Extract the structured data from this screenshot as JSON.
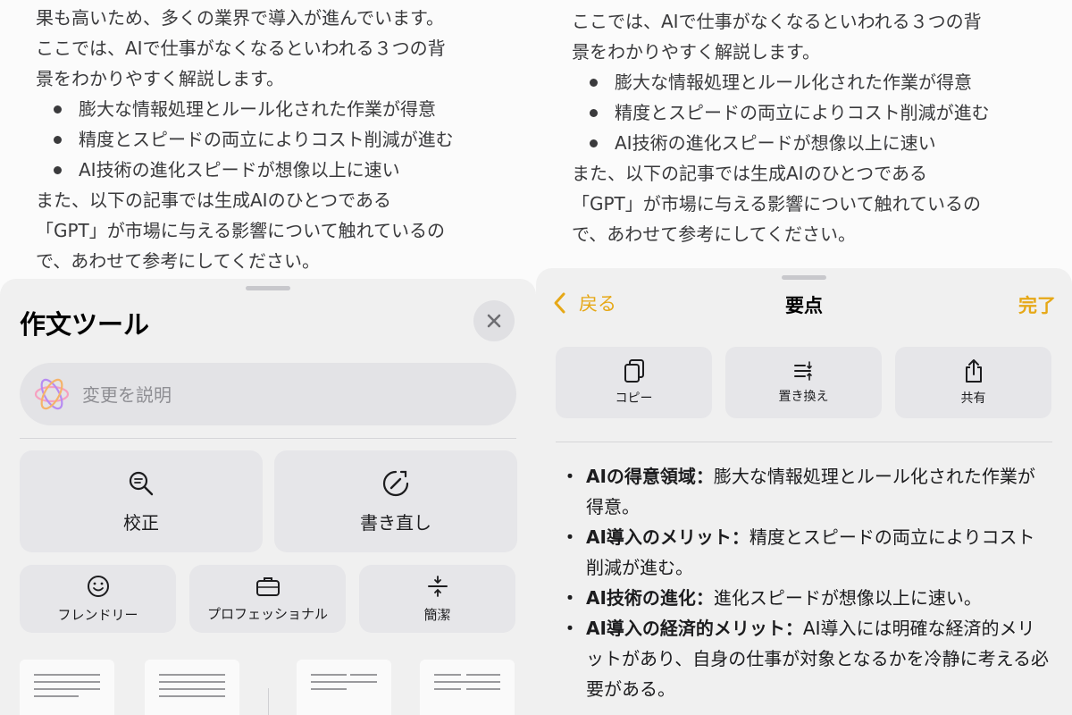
{
  "left_doc": {
    "lines_top": [
      "果も高いため、多くの業界で導入が進んでいます。",
      "ここでは、AIで仕事がなくなるといわれる３つの背",
      "景をわかりやすく解説します。"
    ],
    "bullets": [
      "膨大な情報処理とルール化された作業が得意",
      "精度とスピードの両立によりコスト削減が進む",
      "AI技術の進化スピードが想像以上に速い"
    ],
    "lines_bottom": [
      "また、以下の記事では生成AIのひとつである",
      "「GPT」が市場に与える影響について触れているの",
      "で、あわせて参考にしてください。"
    ]
  },
  "right_doc": {
    "lines_top": [
      "ここでは、AIで仕事がなくなるといわれる３つの背",
      "景をわかりやすく解説します。"
    ],
    "bullets": [
      "膨大な情報処理とルール化された作業が得意",
      "精度とスピードの両立によりコスト削減が進む",
      "AI技術の進化スピードが想像以上に速い"
    ],
    "lines_bottom": [
      "また、以下の記事では生成AIのひとつである",
      "「GPT」が市場に与える影響について触れているの",
      "で、あわせて参考にしてください。"
    ]
  },
  "writing_tools": {
    "title": "作文ツール",
    "describe_placeholder": "変更を説明",
    "proofread_label": "校正",
    "rewrite_label": "書き直し",
    "friendly_label": "フレンドリー",
    "professional_label": "プロフェッショナル",
    "concise_label": "簡潔"
  },
  "summary_sheet": {
    "back_label": "戻る",
    "title": "要点",
    "done_label": "完了",
    "copy_label": "コピー",
    "replace_label": "置き換え",
    "share_label": "共有",
    "items": [
      {
        "heading": "AIの得意領域：",
        "text": "膨大な情報処理とルール化された作業が得意。"
      },
      {
        "heading": "AI導入のメリット：",
        "text": "精度とスピードの両立によりコスト削減が進む。"
      },
      {
        "heading": "AI技術の進化：",
        "text": "進化スピードが想像以上に速い。"
      },
      {
        "heading": "AI導入の経済的メリット：",
        "text": "AI導入には明確な経済的メリットがあり、自身の仕事が対象となるかを冷静に考える必要がある。"
      }
    ]
  },
  "colors": {
    "accent": "#e6a817",
    "sheet_bg": "#f0f0f0",
    "button_bg": "#e6e6e9"
  },
  "icons": [
    "close-icon",
    "apple-intelligence-icon",
    "magnifier-proofread-icon",
    "rewrite-icon",
    "smiley-icon",
    "briefcase-icon",
    "concise-icon",
    "chevron-left-icon",
    "copy-icon",
    "replace-icon",
    "share-icon"
  ]
}
